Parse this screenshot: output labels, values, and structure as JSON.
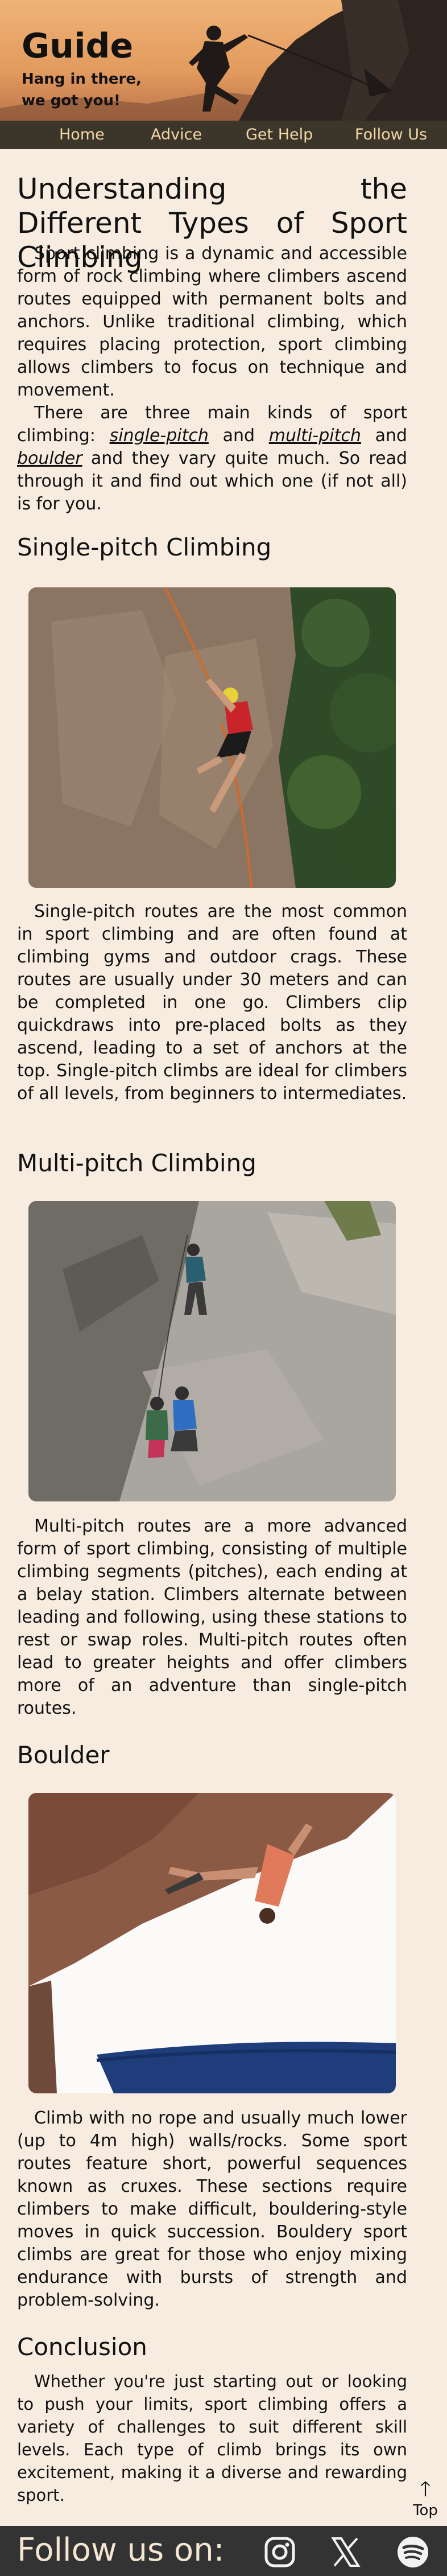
{
  "header": {
    "logo": "Guide",
    "tagline": "Hang in there, we got you!"
  },
  "nav": {
    "items": [
      {
        "label": "Home"
      },
      {
        "label": "Advice"
      },
      {
        "label": "Get Help"
      },
      {
        "label": "Follow Us"
      }
    ]
  },
  "article": {
    "title": "Understanding the Different Types of Sport Climbing",
    "intro": "Sport climbing is a dynamic and accessible form of rock climbing where climbers ascend routes equipped with permanent bolts and anchors. Unlike traditional climbing, which requires placing protection, sport climbing allows climbers to focus on technique and movement.",
    "kinds": {
      "before": "There are three main kinds of sport climbing: ",
      "link1": "single-pitch",
      "and1": " and ",
      "link2": "multi-pitch",
      "and2": " and ",
      "link3": "boulder",
      "after": " and they vary quite much. So read through it and find out which one (if not all) is for you."
    },
    "sections": [
      {
        "heading": "Single-pitch Climbing",
        "text": "Single-pitch routes are the most common in sport climbing and are often found at climbing gyms and outdoor crags. These routes are usually under 30 meters and can be completed in one go. Climbers clip quickdraws into pre-placed bolts as they ascend, leading to a set of anchors at the top. Single-pitch climbs are ideal for climbers of all levels, from beginners to intermediates."
      },
      {
        "heading": "Multi-pitch Climbing",
        "text": "Multi-pitch routes are a more advanced form of sport climbing, consisting of multiple climbing segments (pitches), each ending at a belay station. Climbers alternate between leading and following, using these stations to rest or swap roles. Multi-pitch routes often lead to greater heights and offer climbers more of an adventure than single-pitch routes."
      },
      {
        "heading": "Boulder",
        "text": "Climb with no rope and usually much lower (up to 4m high) walls/rocks. Some sport routes feature short, powerful sequences known as cruxes. These sections require climbers to make difficult, bouldering-style moves in quick succession. Bouldery sport climbs are great for those who enjoy mixing endurance with bursts of strength and problem-solving."
      },
      {
        "heading": "Conclusion",
        "text": "Whether you're just starting out or looking to push your limits, sport climbing offers a variety of challenges to suit different skill levels. Each type of climb brings its own excitement, making it a diverse and rewarding sport."
      }
    ]
  },
  "top_button": {
    "arrow": "🡑",
    "label": "Top"
  },
  "footer": {
    "label": "Follow us on:",
    "icons": [
      "instagram-icon",
      "x-icon",
      "spotify-icon"
    ]
  },
  "colors": {
    "background": "#f7ecdf",
    "nav_bg": "#3b352a",
    "nav_text": "#f2d8a6",
    "footer_bg": "#333333",
    "header_sky": "#e49a5f"
  }
}
